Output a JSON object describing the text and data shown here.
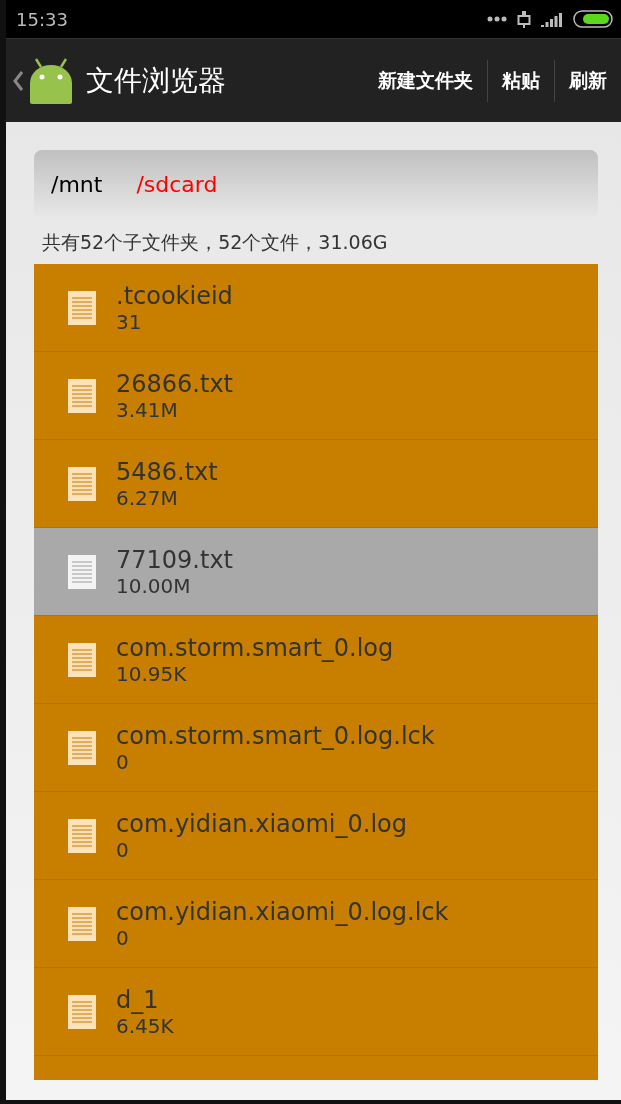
{
  "status_bar": {
    "time": "15:33"
  },
  "toolbar": {
    "title": "文件浏览器",
    "actions": [
      "新建文件夹",
      "粘贴",
      "刷新"
    ]
  },
  "path": [
    {
      "label": "/mnt",
      "selected": false
    },
    {
      "label": "/sdcard",
      "selected": true
    }
  ],
  "summary": "共有52个子文件夹，52个文件，31.06G",
  "files": [
    {
      "name": ".tcookieid",
      "size": "31",
      "selected": false
    },
    {
      "name": "26866.txt",
      "size": "3.41M",
      "selected": false
    },
    {
      "name": "5486.txt",
      "size": "6.27M",
      "selected": false
    },
    {
      "name": "77109.txt",
      "size": "10.00M",
      "selected": true
    },
    {
      "name": "com.storm.smart_0.log",
      "size": "10.95K",
      "selected": false
    },
    {
      "name": "com.storm.smart_0.log.lck",
      "size": "0",
      "selected": false
    },
    {
      "name": "com.yidian.xiaomi_0.log",
      "size": "0",
      "selected": false
    },
    {
      "name": "com.yidian.xiaomi_0.log.lck",
      "size": "0",
      "selected": false
    },
    {
      "name": "d_1",
      "size": "6.45K",
      "selected": false
    }
  ]
}
